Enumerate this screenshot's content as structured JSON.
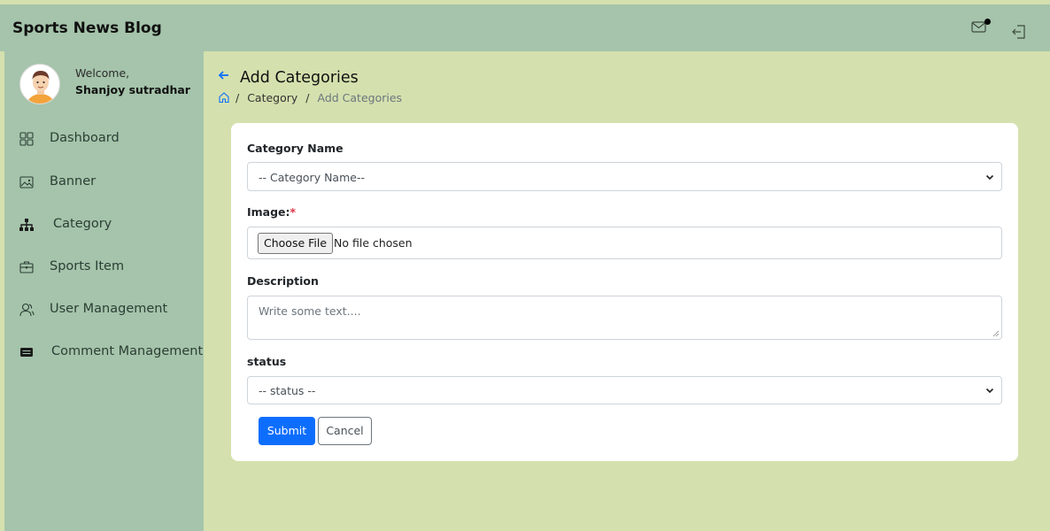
{
  "app": {
    "title": "Sports News Blog"
  },
  "header": {
    "mail_icon": "mail-icon",
    "logout_icon": "logout-icon",
    "notification_dot_color": "#000000"
  },
  "user": {
    "welcome": "Welcome,",
    "name": "Shanjoy sutradhar"
  },
  "sidebar": {
    "items": [
      {
        "label": "Dashboard",
        "icon": "dashboard-grid-icon"
      },
      {
        "label": "Banner",
        "icon": "image-icon"
      },
      {
        "label": "Category",
        "icon": "sitemap-icon"
      },
      {
        "label": "Sports Item",
        "icon": "briefcase-icon"
      },
      {
        "label": "User Management",
        "icon": "users-icon"
      },
      {
        "label": "Comment Management",
        "icon": "comment-card-icon"
      }
    ]
  },
  "page": {
    "title": "Add Categories",
    "breadcrumb": {
      "sep": "/",
      "parent": "Category",
      "current": "Add Categories"
    }
  },
  "form": {
    "category": {
      "label": "Category Name",
      "selected": "-- Category Name--"
    },
    "image": {
      "label": "Image:",
      "required": "*",
      "button": "Choose File",
      "status": "No file chosen"
    },
    "description": {
      "label": "Description",
      "placeholder": "Write some text...."
    },
    "status": {
      "label": "status",
      "selected": "-- status --"
    },
    "submit": "Submit",
    "cancel": "Cancel"
  },
  "colors": {
    "accent": "#0d6efd",
    "header_bg": "#a5c4ab",
    "page_bg": "#d4e1ae",
    "required": "#dc3545"
  }
}
